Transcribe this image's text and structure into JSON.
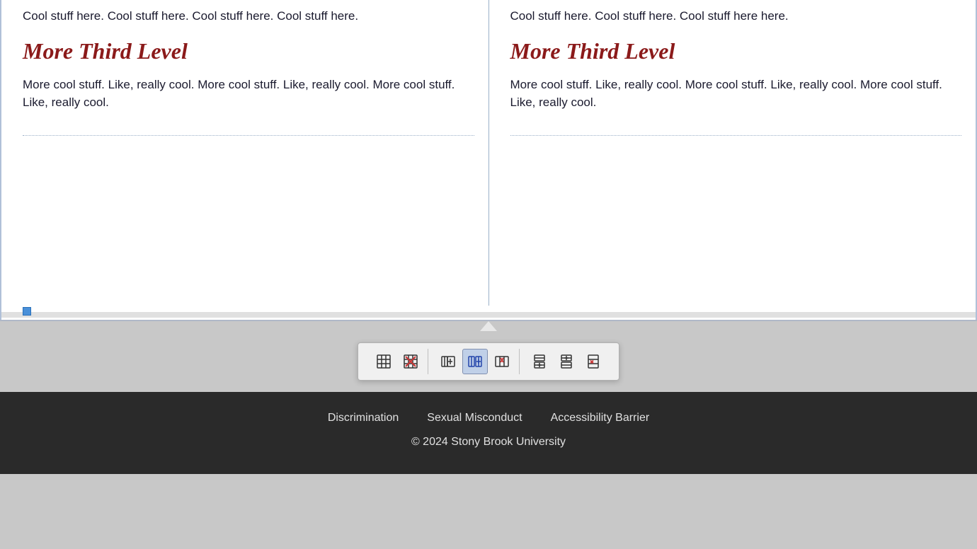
{
  "columns": [
    {
      "top_text": "Cool stuff here. Cool stuff here. Cool stuff here. Cool stuff here.",
      "heading": "More Third Level",
      "bottom_text": "More cool stuff. Like, really cool. More cool stuff. Like, really cool. More cool stuff. Like, really cool."
    },
    {
      "top_text": "Cool stuff here. Cool stuff here. Cool stuff here here.",
      "heading": "More Third Level",
      "bottom_text": "More cool stuff. Like, really cool. More cool stuff. Like, really cool. More cool stuff. Like, really cool."
    }
  ],
  "toolbar": {
    "buttons": [
      {
        "id": "insert-table",
        "label": "Insert Table",
        "group": 1,
        "active": false
      },
      {
        "id": "delete-table",
        "label": "Delete Table",
        "group": 1,
        "active": false
      },
      {
        "id": "insert-col-before",
        "label": "Insert Column Before",
        "group": 2,
        "active": false
      },
      {
        "id": "insert-col-after",
        "label": "Insert Column After",
        "group": 2,
        "active": true
      },
      {
        "id": "delete-col",
        "label": "Delete Column",
        "group": 2,
        "active": false
      },
      {
        "id": "insert-row-above",
        "label": "Insert Row Above",
        "group": 3,
        "active": false
      },
      {
        "id": "insert-row-below",
        "label": "Insert Row Below",
        "group": 3,
        "active": false
      },
      {
        "id": "delete-row",
        "label": "Delete Row",
        "group": 3,
        "active": false
      }
    ]
  },
  "footer": {
    "links": [
      {
        "label": "Discrimination",
        "url": "#"
      },
      {
        "label": "Sexual Misconduct",
        "url": "#"
      },
      {
        "label": "Accessibility Barrier",
        "url": "#"
      }
    ],
    "copyright": "© 2024 Stony Brook University"
  }
}
